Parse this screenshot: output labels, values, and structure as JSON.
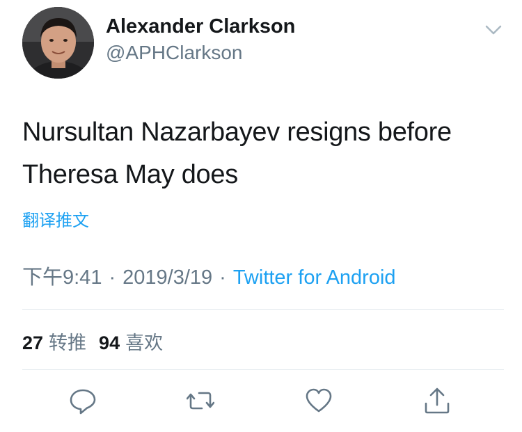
{
  "tweet": {
    "author": {
      "display_name": "Alexander Clarkson",
      "handle": "@APHClarkson",
      "avatar_icon": "user-avatar-photo"
    },
    "menu_icon": "chevron-down-icon",
    "text": "Nursultan Nazarbayev resigns before Theresa May does",
    "translate_label": "翻译推文",
    "time": "下午9:41",
    "date": "2019/3/19",
    "separator": "·",
    "source": "Twitter for Android",
    "stats": {
      "retweets_count": "27",
      "retweets_label": "转推",
      "likes_count": "94",
      "likes_label": "喜欢"
    },
    "actions": [
      "reply-icon",
      "retweet-icon",
      "like-icon",
      "share-icon"
    ]
  },
  "colors": {
    "text_primary": "#14171a",
    "text_secondary": "#657786",
    "link": "#1da1f2",
    "divider": "#e1e8ed",
    "icon": "#657786"
  }
}
